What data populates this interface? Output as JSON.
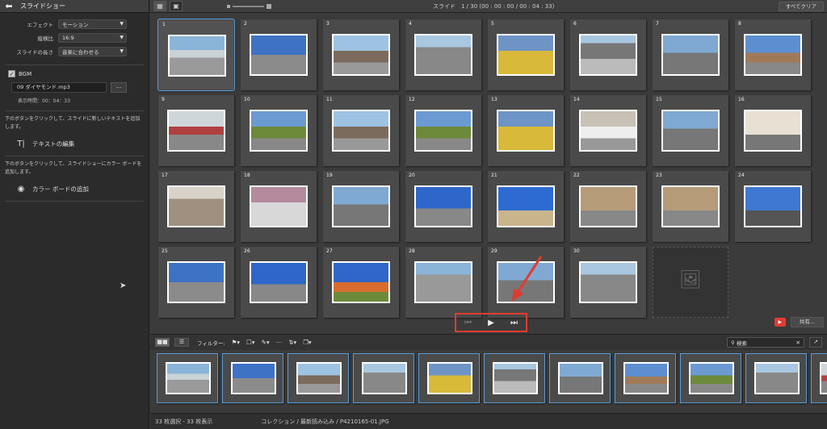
{
  "left_panel": {
    "title": "スライドショー",
    "effect_label": "エフェクト",
    "effect_value": "モーション",
    "aspect_label": "縦横比",
    "aspect_value": "16:9",
    "length_label": "スライドの長さ",
    "length_value": "音楽に合わせる",
    "bgm_label": "BGM",
    "bgm_file": "09 ダイヤモンド.mp3",
    "bgm_more": "...",
    "show_time": "表示時間：00：04：33",
    "text_desc": "下のボタンをクリックして、スライドに新しいテキストを追加します。",
    "text_button": "テキストの編集",
    "color_desc": "下のボタンをクリックして、スライドショーにカラー ボードを追加します。",
    "color_button": "カラー ボードの追加"
  },
  "topbar": {
    "counter": "スライド　1 / 30 (00 : 00 : 00 / 00 : 04 : 33)",
    "clear_all": "すべてクリア"
  },
  "slides": [
    {
      "n": "1"
    },
    {
      "n": "2"
    },
    {
      "n": "3"
    },
    {
      "n": "4"
    },
    {
      "n": "5"
    },
    {
      "n": "6"
    },
    {
      "n": "7"
    },
    {
      "n": "8"
    },
    {
      "n": "9"
    },
    {
      "n": "10"
    },
    {
      "n": "11"
    },
    {
      "n": "12"
    },
    {
      "n": "13"
    },
    {
      "n": "14"
    },
    {
      "n": "15"
    },
    {
      "n": "16"
    },
    {
      "n": "17"
    },
    {
      "n": "18"
    },
    {
      "n": "19"
    },
    {
      "n": "20"
    },
    {
      "n": "21"
    },
    {
      "n": "22"
    },
    {
      "n": "23"
    },
    {
      "n": "24"
    },
    {
      "n": "25"
    },
    {
      "n": "26"
    },
    {
      "n": "27"
    },
    {
      "n": "28"
    },
    {
      "n": "29"
    },
    {
      "n": "30"
    }
  ],
  "playback": {
    "prev_icon": "skip-back-icon",
    "play_icon": "play-icon",
    "next_icon": "skip-forward-icon"
  },
  "share": {
    "label": "共有..."
  },
  "filterbar": {
    "filter_label": "フィルター:",
    "search_value": "検索"
  },
  "status": {
    "selection": "33 枚選択 - 33 枚表示",
    "path": "コレクション / 最新読み込み / P4210165-01.JPG"
  },
  "colors": {
    "accent": "#5b9bd5",
    "highlight": "#e23b2e"
  }
}
